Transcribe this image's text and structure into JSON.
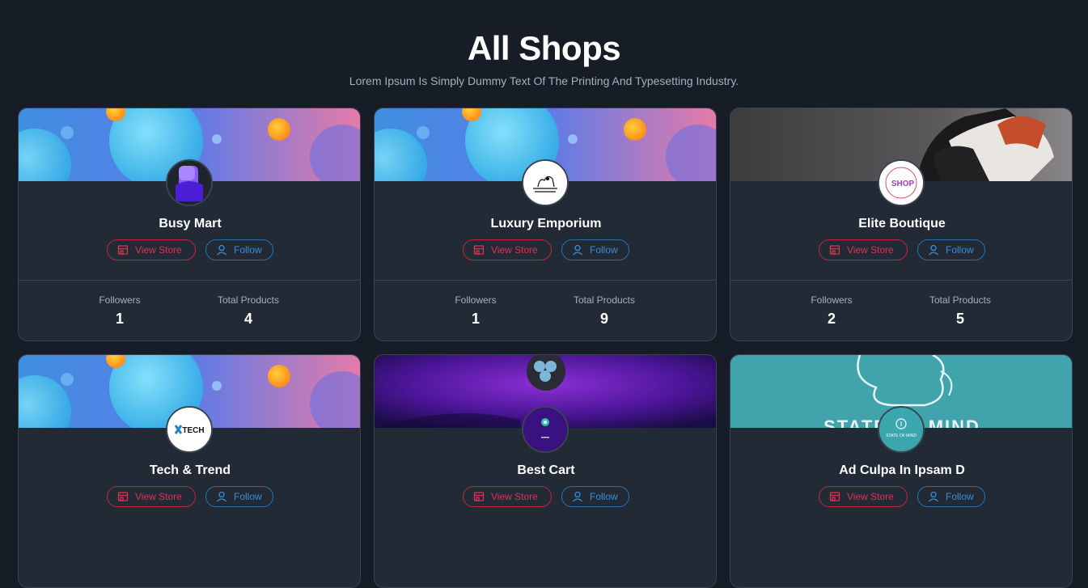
{
  "header": {
    "title": "All Shops",
    "subtitle": "Lorem Ipsum Is Simply Dummy Text Of The Printing And Typesetting Industry."
  },
  "labels": {
    "view_store": "View Store",
    "follow": "Follow",
    "followers": "Followers",
    "total_products": "Total Products"
  },
  "shops": [
    {
      "name": "Busy Mart",
      "followers": "1",
      "total_products": "4",
      "banner": "bubbles-gradient",
      "logo": "purple-3d-logo"
    },
    {
      "name": "Luxury Emporium",
      "followers": "1",
      "total_products": "9",
      "banner": "bubbles-gradient",
      "logo": "sketch-logo"
    },
    {
      "name": "Elite Boutique",
      "followers": "2",
      "total_products": "5",
      "banner": "sneaker-photo",
      "logo": "shop-logo",
      "logo_text": "SHOP"
    },
    {
      "name": "Tech & Trend",
      "followers": "",
      "total_products": "",
      "banner": "bubbles-gradient",
      "logo": "tech-logo",
      "logo_text": "TECH"
    },
    {
      "name": "Best Cart",
      "followers": "",
      "total_products": "",
      "banner": "purple-glow",
      "logo": "dark-purple-logo"
    },
    {
      "name": "Ad Culpa In Ipsam D",
      "followers": "",
      "total_products": "",
      "banner": "state-of-mind-teal",
      "logo": "state-of-mind-logo",
      "banner_text": "STATE OF MIND",
      "logo_text": "STATE OF MIND"
    }
  ],
  "colors": {
    "background": "#161d26",
    "card": "#212a35",
    "view_store": "#e03355",
    "follow": "#3b8eda"
  }
}
